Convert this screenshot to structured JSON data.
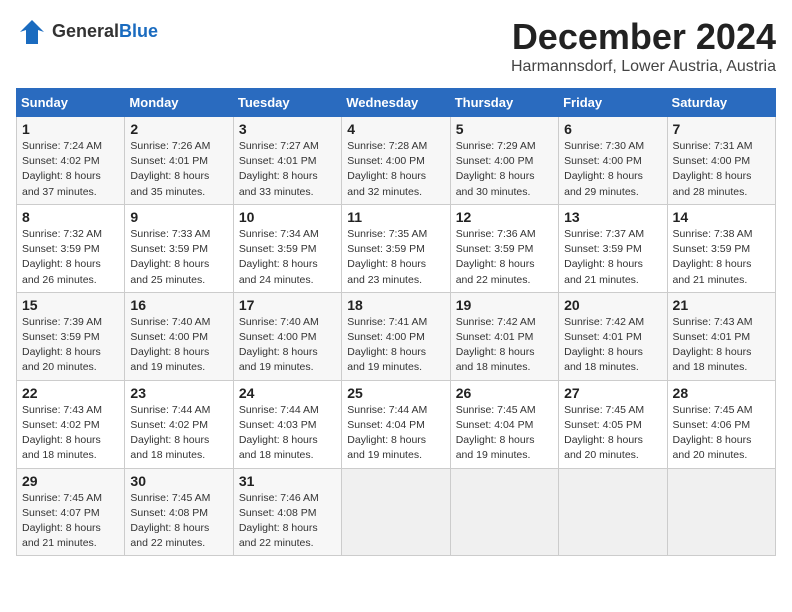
{
  "header": {
    "logo_general": "General",
    "logo_blue": "Blue",
    "month": "December 2024",
    "location": "Harmannsdorf, Lower Austria, Austria"
  },
  "days_of_week": [
    "Sunday",
    "Monday",
    "Tuesday",
    "Wednesday",
    "Thursday",
    "Friday",
    "Saturday"
  ],
  "weeks": [
    [
      {
        "day": "1",
        "text": "Sunrise: 7:24 AM\nSunset: 4:02 PM\nDaylight: 8 hours\nand 37 minutes."
      },
      {
        "day": "2",
        "text": "Sunrise: 7:26 AM\nSunset: 4:01 PM\nDaylight: 8 hours\nand 35 minutes."
      },
      {
        "day": "3",
        "text": "Sunrise: 7:27 AM\nSunset: 4:01 PM\nDaylight: 8 hours\nand 33 minutes."
      },
      {
        "day": "4",
        "text": "Sunrise: 7:28 AM\nSunset: 4:00 PM\nDaylight: 8 hours\nand 32 minutes."
      },
      {
        "day": "5",
        "text": "Sunrise: 7:29 AM\nSunset: 4:00 PM\nDaylight: 8 hours\nand 30 minutes."
      },
      {
        "day": "6",
        "text": "Sunrise: 7:30 AM\nSunset: 4:00 PM\nDaylight: 8 hours\nand 29 minutes."
      },
      {
        "day": "7",
        "text": "Sunrise: 7:31 AM\nSunset: 4:00 PM\nDaylight: 8 hours\nand 28 minutes."
      }
    ],
    [
      {
        "day": "8",
        "text": "Sunrise: 7:32 AM\nSunset: 3:59 PM\nDaylight: 8 hours\nand 26 minutes."
      },
      {
        "day": "9",
        "text": "Sunrise: 7:33 AM\nSunset: 3:59 PM\nDaylight: 8 hours\nand 25 minutes."
      },
      {
        "day": "10",
        "text": "Sunrise: 7:34 AM\nSunset: 3:59 PM\nDaylight: 8 hours\nand 24 minutes."
      },
      {
        "day": "11",
        "text": "Sunrise: 7:35 AM\nSunset: 3:59 PM\nDaylight: 8 hours\nand 23 minutes."
      },
      {
        "day": "12",
        "text": "Sunrise: 7:36 AM\nSunset: 3:59 PM\nDaylight: 8 hours\nand 22 minutes."
      },
      {
        "day": "13",
        "text": "Sunrise: 7:37 AM\nSunset: 3:59 PM\nDaylight: 8 hours\nand 21 minutes."
      },
      {
        "day": "14",
        "text": "Sunrise: 7:38 AM\nSunset: 3:59 PM\nDaylight: 8 hours\nand 21 minutes."
      }
    ],
    [
      {
        "day": "15",
        "text": "Sunrise: 7:39 AM\nSunset: 3:59 PM\nDaylight: 8 hours\nand 20 minutes."
      },
      {
        "day": "16",
        "text": "Sunrise: 7:40 AM\nSunset: 4:00 PM\nDaylight: 8 hours\nand 19 minutes."
      },
      {
        "day": "17",
        "text": "Sunrise: 7:40 AM\nSunset: 4:00 PM\nDaylight: 8 hours\nand 19 minutes."
      },
      {
        "day": "18",
        "text": "Sunrise: 7:41 AM\nSunset: 4:00 PM\nDaylight: 8 hours\nand 19 minutes."
      },
      {
        "day": "19",
        "text": "Sunrise: 7:42 AM\nSunset: 4:01 PM\nDaylight: 8 hours\nand 18 minutes."
      },
      {
        "day": "20",
        "text": "Sunrise: 7:42 AM\nSunset: 4:01 PM\nDaylight: 8 hours\nand 18 minutes."
      },
      {
        "day": "21",
        "text": "Sunrise: 7:43 AM\nSunset: 4:01 PM\nDaylight: 8 hours\nand 18 minutes."
      }
    ],
    [
      {
        "day": "22",
        "text": "Sunrise: 7:43 AM\nSunset: 4:02 PM\nDaylight: 8 hours\nand 18 minutes."
      },
      {
        "day": "23",
        "text": "Sunrise: 7:44 AM\nSunset: 4:02 PM\nDaylight: 8 hours\nand 18 minutes."
      },
      {
        "day": "24",
        "text": "Sunrise: 7:44 AM\nSunset: 4:03 PM\nDaylight: 8 hours\nand 18 minutes."
      },
      {
        "day": "25",
        "text": "Sunrise: 7:44 AM\nSunset: 4:04 PM\nDaylight: 8 hours\nand 19 minutes."
      },
      {
        "day": "26",
        "text": "Sunrise: 7:45 AM\nSunset: 4:04 PM\nDaylight: 8 hours\nand 19 minutes."
      },
      {
        "day": "27",
        "text": "Sunrise: 7:45 AM\nSunset: 4:05 PM\nDaylight: 8 hours\nand 20 minutes."
      },
      {
        "day": "28",
        "text": "Sunrise: 7:45 AM\nSunset: 4:06 PM\nDaylight: 8 hours\nand 20 minutes."
      }
    ],
    [
      {
        "day": "29",
        "text": "Sunrise: 7:45 AM\nSunset: 4:07 PM\nDaylight: 8 hours\nand 21 minutes."
      },
      {
        "day": "30",
        "text": "Sunrise: 7:45 AM\nSunset: 4:08 PM\nDaylight: 8 hours\nand 22 minutes."
      },
      {
        "day": "31",
        "text": "Sunrise: 7:46 AM\nSunset: 4:08 PM\nDaylight: 8 hours\nand 22 minutes."
      },
      null,
      null,
      null,
      null
    ]
  ]
}
